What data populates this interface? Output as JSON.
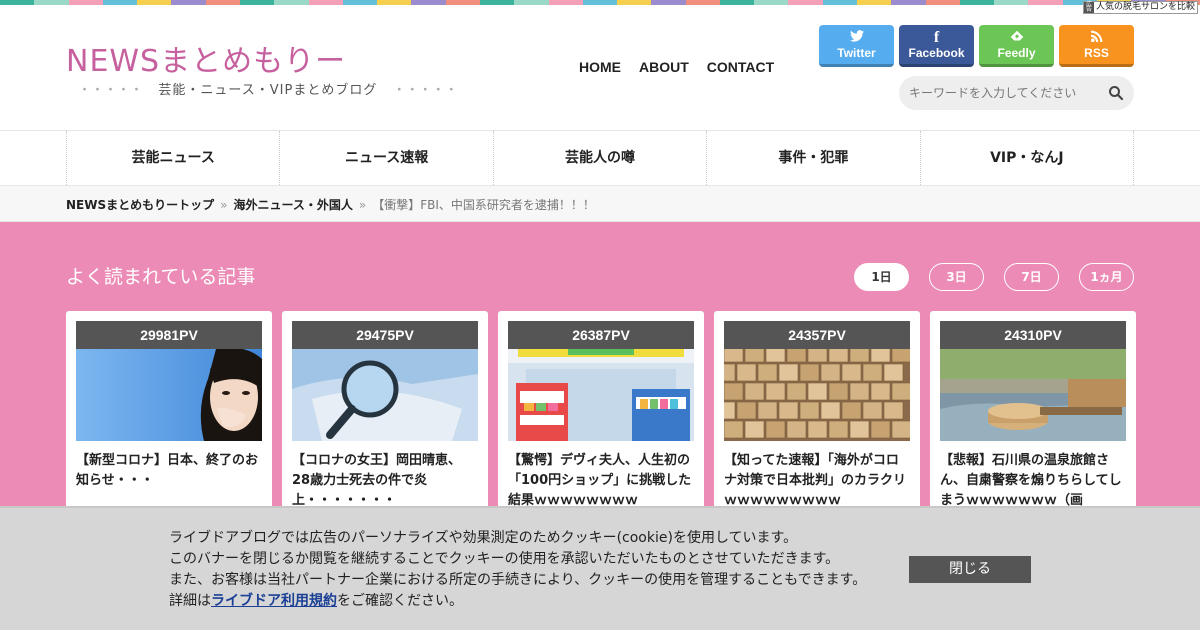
{
  "stripe_colors": [
    "#3db39e",
    "#9ad8c8",
    "#f2a1b8",
    "#62c0d8",
    "#f5d04f",
    "#9b8ccf",
    "#f08f7e",
    "#3db39e",
    "#9ad8c8",
    "#f2a1b8",
    "#62c0d8",
    "#f5d04f",
    "#9b8ccf",
    "#f08f7e",
    "#3db39e",
    "#9ad8c8",
    "#f2a1b8",
    "#62c0d8",
    "#f5d04f",
    "#9b8ccf",
    "#f08f7e",
    "#3db39e",
    "#9ad8c8",
    "#f2a1b8",
    "#62c0d8",
    "#f5d04f",
    "#9b8ccf",
    "#f08f7e",
    "#3db39e",
    "#9ad8c8",
    "#f2a1b8",
    "#62c0d8",
    "#f5d04f",
    "#9b8ccf",
    "#f08f7e"
  ],
  "ad_tag": {
    "pr": "広告",
    "text": "人気の脱毛サロンを比較"
  },
  "site": {
    "title": "NEWSまとめもりー",
    "subtitle": "芸能・ニュース・VIPまとめブログ",
    "subtitle_dots": "・・・・・",
    "brand_color": "#c6609e"
  },
  "topnav": [
    "HOME",
    "ABOUT",
    "CONTACT"
  ],
  "social": [
    {
      "name": "twitter",
      "label": "Twitter",
      "icon": "twitter-bird-icon",
      "glyph": "🐦",
      "color": "#55acee"
    },
    {
      "name": "facebook",
      "label": "Facebook",
      "icon": "facebook-f-icon",
      "glyph": "f",
      "color": "#3b5998"
    },
    {
      "name": "feedly",
      "label": "Feedly",
      "icon": "feedly-icon",
      "glyph": "◆",
      "color": "#6cc655"
    },
    {
      "name": "rss",
      "label": "RSS",
      "icon": "rss-icon",
      "glyph": "◉",
      "color": "#f7931e"
    }
  ],
  "search": {
    "placeholder": "キーワードを入力してください",
    "icon": "search-icon"
  },
  "categories": [
    "芸能ニュース",
    "ニュース速報",
    "芸能人の噂",
    "事件・犯罪",
    "VIP・なんJ"
  ],
  "breadcrumb": {
    "items": [
      "NEWSまとめもりートップ",
      "海外ニュース・外国人"
    ],
    "separator": "»",
    "current": "【衝撃】FBI、中国系研究者を逮捕！！！"
  },
  "popular": {
    "heading": "よく読まれている記事",
    "periods": [
      "1日",
      "3日",
      "7日",
      "1ヵ月"
    ],
    "active_period": "1日",
    "accent": "#ec8bb5",
    "cards": [
      {
        "pv": "29981PV",
        "title": "【新型コロナ】日本、終了のお知らせ・・・",
        "image": "woman-covering-mouth-photo"
      },
      {
        "pv": "29475PV",
        "title": "【コロナの女王】岡田晴恵、28歳力士死去の件で炎上・・・・・・・",
        "image": "magnifier-mask-photo"
      },
      {
        "pv": "26387PV",
        "title": "【驚愕】デヴィ夫人、人生初の「100円ショップ」に挑戦した結果ｗｗｗｗｗｗｗｗ",
        "image": "shop-illustration"
      },
      {
        "pv": "24357PV",
        "title": "【知ってた速報】「海外がコロナ対策で日本批判」のカラクリｗｗｗｗｗｗｗｗｗ",
        "image": "fake-news-blocks-photo"
      },
      {
        "pv": "24310PV",
        "title": "【悲報】石川県の温泉旅館さん、自粛警察を煽りちらしてしまうｗｗｗｗｗｗｗ（画",
        "image": "onsen-photo"
      }
    ]
  },
  "cookie": {
    "line1": "ライブドアブログでは広告のパーソナライズや効果測定のためクッキー(cookie)を使用しています。",
    "line2": "このバナーを閉じるか閲覧を継続することでクッキーの使用を承認いただいたものとさせていただきます。",
    "line3": "また、お客様は当社パートナー企業における所定の手続きにより、クッキーの使用を管理することもできます。",
    "line4_pre": "詳細は",
    "line4_link": "ライブドア利用規約",
    "line4_post": "をご確認ください。",
    "close_label": "閉じる"
  }
}
